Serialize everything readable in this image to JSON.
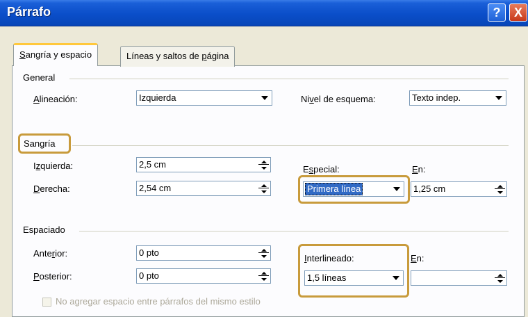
{
  "window": {
    "title": "Párrafo",
    "help_icon": "?",
    "close_icon": "X"
  },
  "tabs": [
    {
      "label_pre": "",
      "label_ul": "S",
      "label_post": "angría y espacio",
      "active": true
    },
    {
      "label_pre": "Líneas y saltos de ",
      "label_ul": "p",
      "label_post": "ágina",
      "active": false
    }
  ],
  "general": {
    "title": "General",
    "alineacion": {
      "label_ul": "A",
      "label_post": "lineación:",
      "value": "Izquierda"
    },
    "nivel": {
      "label_pre": "Ni",
      "label_ul": "v",
      "label_post": "el de esquema:",
      "value": "Texto indep."
    }
  },
  "sangria": {
    "title": "Sangría",
    "izquierda": {
      "label_pre": "I",
      "label_ul": "z",
      "label_post": "quierda:",
      "value": "2,5 cm"
    },
    "derecha": {
      "label_ul": "D",
      "label_post": "erecha:",
      "value": "2,54 cm"
    },
    "especial": {
      "label_pre": "E",
      "label_ul": "s",
      "label_post": "pecial:",
      "value": "Primera línea"
    },
    "en": {
      "label_ul": "E",
      "label_post": "n:",
      "value": "1,25 cm"
    }
  },
  "espaciado": {
    "title": "Espaciado",
    "anterior": {
      "label_pre": "Ante",
      "label_ul": "r",
      "label_post": "ior:",
      "value": "0 pto"
    },
    "posterior": {
      "label_ul": "P",
      "label_post": "osterior:",
      "value": "0 pto"
    },
    "interlineado": {
      "label_ul": "I",
      "label_post": "nterlineado:",
      "value": "1,5 líneas"
    },
    "en": {
      "label_ul": "E",
      "label_post": "n:",
      "value": ""
    },
    "no_agregar": "No agregar espacio entre párrafos del mismo estilo"
  },
  "colors": {
    "highlight": "#c89b3c",
    "titlebar": "#0a4ec9",
    "selection": "#316ac5"
  }
}
